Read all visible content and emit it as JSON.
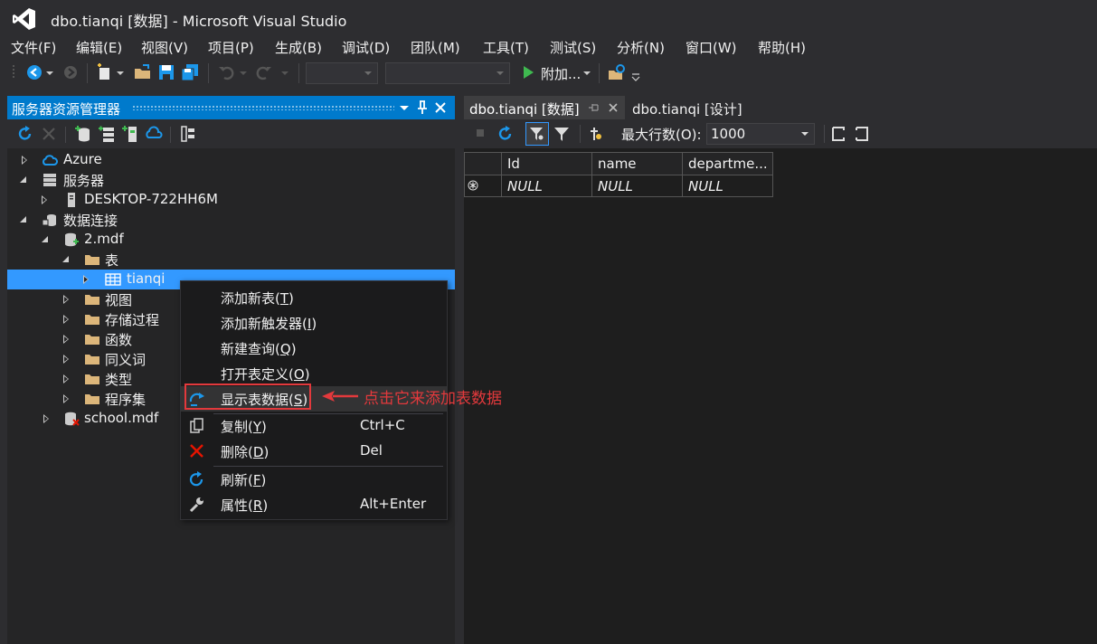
{
  "window": {
    "title": "dbo.tianqi [数据] - Microsoft Visual Studio"
  },
  "menu": [
    "文件(F)",
    "编辑(E)",
    "视图(V)",
    "项目(P)",
    "生成(B)",
    "调试(D)",
    "团队(M)",
    "工具(T)",
    "测试(S)",
    "分析(N)",
    "窗口(W)",
    "帮助(H)"
  ],
  "toolbar": {
    "attach_label": "附加...",
    "config_value": "",
    "platform_value": ""
  },
  "server_explorer": {
    "title": "服务器资源管理器",
    "tree": [
      {
        "label": "Azure",
        "icon": "azure-cloud-icon",
        "level": 0,
        "expanded": false
      },
      {
        "label": "服务器",
        "icon": "server-icon",
        "level": 0,
        "expanded": true
      },
      {
        "label": "DESKTOP-722HH6M",
        "icon": "computer-icon",
        "level": 1,
        "expanded": false
      },
      {
        "label": "数据连接",
        "icon": "data-connections-icon",
        "level": 0,
        "expanded": true
      },
      {
        "label": "2.mdf",
        "icon": "database-icon",
        "level": 1,
        "expanded": true
      },
      {
        "label": "表",
        "icon": "folder-icon",
        "level": 2,
        "expanded": true
      },
      {
        "label": "tianqi",
        "icon": "table-icon",
        "level": 3,
        "expanded": false,
        "selected": true
      },
      {
        "label": "视图",
        "icon": "folder-icon",
        "level": 2,
        "expanded": false
      },
      {
        "label": "存储过程",
        "icon": "folder-icon",
        "level": 2,
        "expanded": false
      },
      {
        "label": "函数",
        "icon": "folder-icon",
        "level": 2,
        "expanded": false
      },
      {
        "label": "同义词",
        "icon": "folder-icon",
        "level": 2,
        "expanded": false
      },
      {
        "label": "类型",
        "icon": "folder-icon",
        "level": 2,
        "expanded": false
      },
      {
        "label": "程序集",
        "icon": "folder-icon",
        "level": 2,
        "expanded": false
      },
      {
        "label": "school.mdf",
        "icon": "database-error-icon",
        "level": 1,
        "expanded": false
      }
    ]
  },
  "context_menu": {
    "items": [
      {
        "label": "添加新表",
        "key": "T",
        "shortcut": ""
      },
      {
        "label": "添加新触发器",
        "key": "I",
        "shortcut": ""
      },
      {
        "label": "新建查询",
        "key": "Q",
        "shortcut": ""
      },
      {
        "label": "打开表定义",
        "key": "O",
        "shortcut": ""
      },
      {
        "label": "显示表数据",
        "key": "S",
        "shortcut": ""
      },
      {
        "label": "复制",
        "key": "Y",
        "shortcut": "Ctrl+C"
      },
      {
        "label": "删除",
        "key": "D",
        "shortcut": "Del"
      },
      {
        "label": "刷新",
        "key": "F",
        "shortcut": ""
      },
      {
        "label": "属性",
        "key": "R",
        "shortcut": "Alt+Enter"
      }
    ]
  },
  "annotation": {
    "text": "点击它来添加表数据",
    "color": "#e3393c"
  },
  "documents": {
    "tabs": [
      {
        "label": "dbo.tianqi [数据]",
        "active": true
      },
      {
        "label": "dbo.tianqi [设计]",
        "active": false
      }
    ],
    "max_rows_label": "最大行数(O):",
    "max_rows_value": "1000",
    "grid": {
      "columns": [
        "Id",
        "name",
        "departme..."
      ],
      "rows": [
        [
          "NULL",
          "NULL",
          "NULL"
        ]
      ]
    }
  },
  "colors": {
    "accent": "#007acc",
    "selection": "#3399ff",
    "background": "#2d2d30"
  }
}
